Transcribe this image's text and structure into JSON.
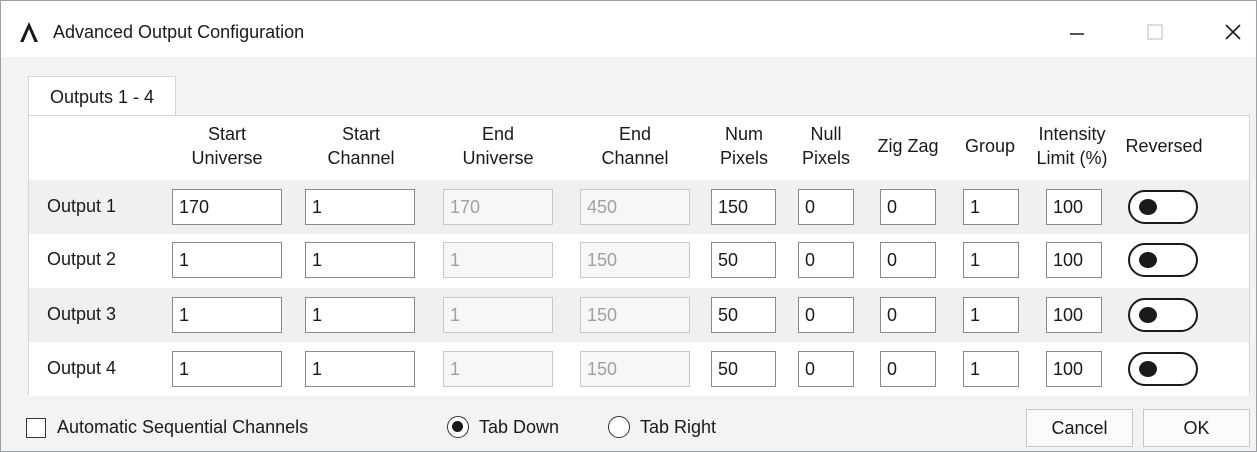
{
  "window": {
    "title": "Advanced Output Configuration",
    "controls": {
      "minimize": "minimize-icon",
      "maximize": "maximize-icon",
      "close": "close-icon"
    }
  },
  "tabs": [
    {
      "label": "Outputs 1 - 4",
      "selected": true
    }
  ],
  "columns": {
    "start_universe": [
      "Start",
      "Universe"
    ],
    "start_channel": [
      "Start",
      "Channel"
    ],
    "end_universe": [
      "End",
      "Universe"
    ],
    "end_channel": [
      "End",
      "Channel"
    ],
    "num_pixels": [
      "Num",
      "Pixels"
    ],
    "null_pixels": [
      "Null",
      "Pixels"
    ],
    "zig_zag": "Zig Zag",
    "group": "Group",
    "intensity": [
      "Intensity",
      "Limit (%)"
    ],
    "reversed": "Reversed"
  },
  "rows": [
    {
      "label": "Output 1",
      "start_universe": "170",
      "start_channel": "1",
      "end_universe": "170",
      "end_channel": "450",
      "num_pixels": "150",
      "null_pixels": "0",
      "zig_zag": "0",
      "group": "1",
      "intensity": "100",
      "reversed": false
    },
    {
      "label": "Output 2",
      "start_universe": "1",
      "start_channel": "1",
      "end_universe": "1",
      "end_channel": "150",
      "num_pixels": "50",
      "null_pixels": "0",
      "zig_zag": "0",
      "group": "1",
      "intensity": "100",
      "reversed": false
    },
    {
      "label": "Output 3",
      "start_universe": "1",
      "start_channel": "1",
      "end_universe": "1",
      "end_channel": "150",
      "num_pixels": "50",
      "null_pixels": "0",
      "zig_zag": "0",
      "group": "1",
      "intensity": "100",
      "reversed": false
    },
    {
      "label": "Output 4",
      "start_universe": "1",
      "start_channel": "1",
      "end_universe": "1",
      "end_channel": "150",
      "num_pixels": "50",
      "null_pixels": "0",
      "zig_zag": "0",
      "group": "1",
      "intensity": "100",
      "reversed": false
    }
  ],
  "footer": {
    "auto_sequential_label": "Automatic Sequential Channels",
    "auto_sequential_checked": false,
    "tab_down_label": "Tab Down",
    "tab_down_selected": true,
    "tab_right_label": "Tab Right",
    "tab_right_selected": false,
    "cancel_label": "Cancel",
    "ok_label": "OK"
  },
  "colors": {
    "window_bg": "#f3f3f3",
    "row_alt": "#f0f0f0",
    "disabled_text": "#a0a0a0"
  }
}
